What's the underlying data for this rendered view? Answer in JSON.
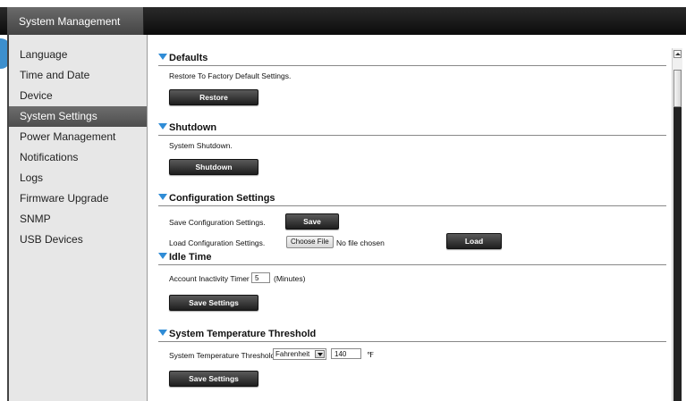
{
  "window": {
    "title": "System Management"
  },
  "sidebar": {
    "items": [
      {
        "label": "Language"
      },
      {
        "label": "Time and Date"
      },
      {
        "label": "Device"
      },
      {
        "label": "System Settings",
        "active": true
      },
      {
        "label": "Power Management"
      },
      {
        "label": "Notifications"
      },
      {
        "label": "Logs"
      },
      {
        "label": "Firmware Upgrade"
      },
      {
        "label": "SNMP"
      },
      {
        "label": "USB Devices"
      }
    ]
  },
  "sections": {
    "defaults": {
      "title": "Defaults",
      "desc": "Restore To Factory Default Settings.",
      "button": "Restore"
    },
    "shutdown": {
      "title": "Shutdown",
      "desc": "System Shutdown.",
      "button": "Shutdown"
    },
    "config": {
      "title": "Configuration Settings",
      "save_desc": "Save Configuration Settings.",
      "save_button": "Save",
      "load_desc": "Load Configuration Settings.",
      "choose_file": "Choose File",
      "file_status": "No file chosen",
      "load_button": "Load"
    },
    "idle": {
      "title": "Idle Time",
      "label": "Account Inactivity Timer",
      "value": "5",
      "unit": "(Minutes)",
      "button": "Save Settings"
    },
    "temperature": {
      "title": "System Temperature Threshold",
      "label": "System Temperature Threshold",
      "unit_select": "Fahrenheit",
      "value": "140",
      "unit_symbol": "℉",
      "button": "Save Settings"
    }
  },
  "colors": {
    "accent": "#2f8cd6",
    "titlebar": "#111111",
    "sidebar_bg": "#e7e7e7"
  }
}
